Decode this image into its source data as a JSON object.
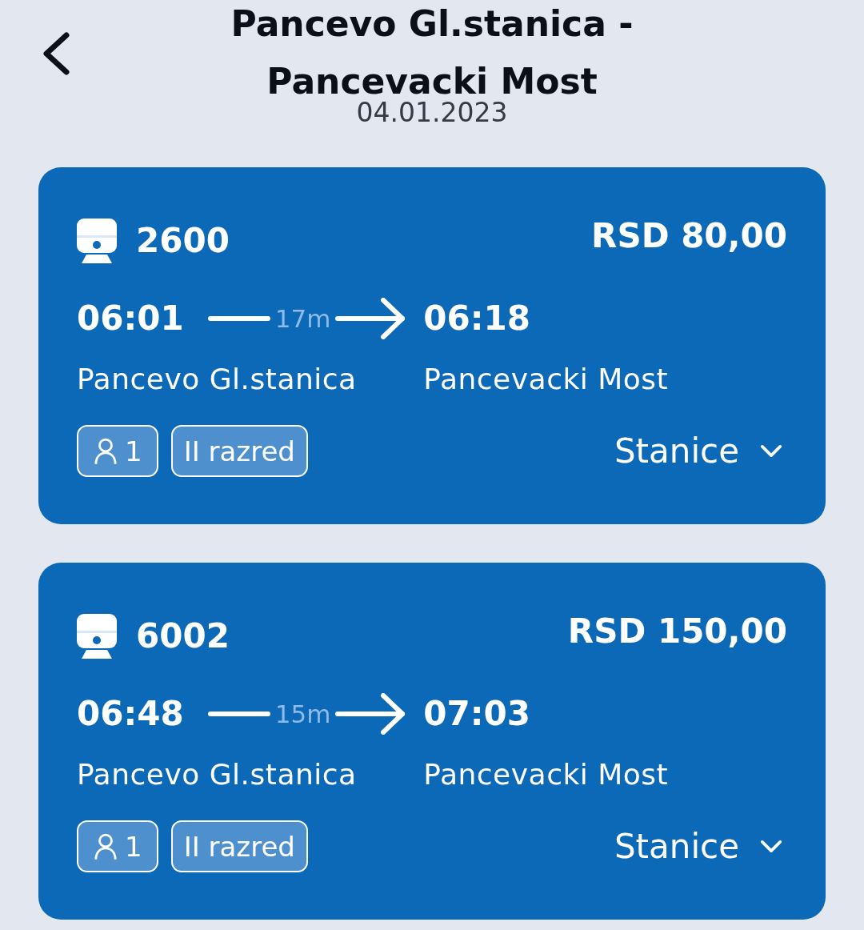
{
  "header": {
    "title": "Pancevo Gl.stanica - Pancevacki Most",
    "date": "04.01.2023"
  },
  "trips": [
    {
      "train_number": "2600",
      "price": "RSD 80,00",
      "departure_time": "06:01",
      "duration": "17m",
      "arrival_time": "06:18",
      "from": "Pancevo Gl.stanica",
      "to": "Pancevacki Most",
      "passengers": "1",
      "travel_class": "II razred",
      "stations_label": "Stanice",
      "expanded": false
    },
    {
      "train_number": "6002",
      "price": "RSD 150,00",
      "departure_time": "06:48",
      "duration": "15m",
      "arrival_time": "07:03",
      "from": "Pancevo Gl.stanica",
      "to": "Pancevacki Most",
      "passengers": "1",
      "travel_class": "II razred",
      "stations_label": "Stanice",
      "expanded": false
    }
  ]
}
